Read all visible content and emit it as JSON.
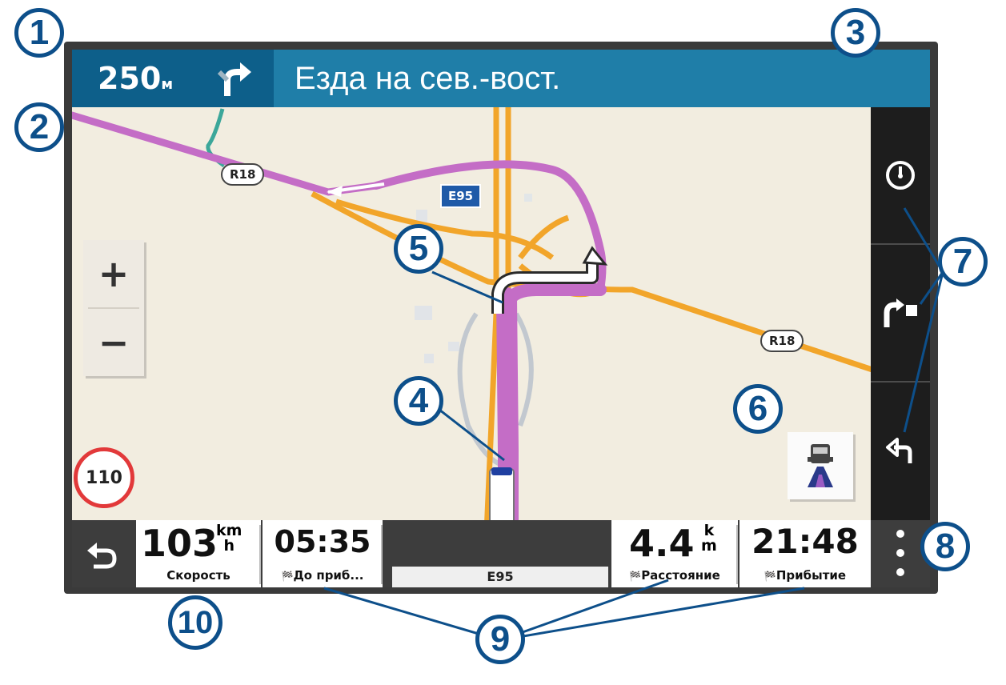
{
  "header": {
    "distance_value": "250",
    "distance_unit": "м",
    "turn_icon": "turn-right-icon",
    "street_instruction": "Езда на сев.-вост."
  },
  "map": {
    "route_color": "#c46dc6",
    "road_color": "#f2a52a",
    "road_shields": [
      "R18",
      "R18"
    ],
    "euro_shield": "E95",
    "speed_limit": "110"
  },
  "zoom": {
    "in_label": "+",
    "out_label": "−"
  },
  "right_panel": {
    "items": [
      {
        "icon": "speedometer-icon"
      },
      {
        "icon": "route-flag-icon"
      },
      {
        "icon": "turn-left-arrow-icon"
      }
    ]
  },
  "lane_assist_icon": "truck-lane-icon",
  "bottom_bar": {
    "speed": {
      "value": "103",
      "unit_top": "km",
      "unit_bottom": "h",
      "label": "Скорость"
    },
    "time_to_arrival": {
      "value": "05:35",
      "label": "До приб..."
    },
    "street": "E95",
    "distance": {
      "value": "4.4",
      "unit_top": "k",
      "unit_bottom": "m",
      "label": "Расстояние"
    },
    "arrival": {
      "value": "21:48",
      "label": "Прибытие"
    }
  },
  "callouts": [
    "1",
    "2",
    "3",
    "4",
    "5",
    "6",
    "7",
    "8",
    "9",
    "10"
  ]
}
